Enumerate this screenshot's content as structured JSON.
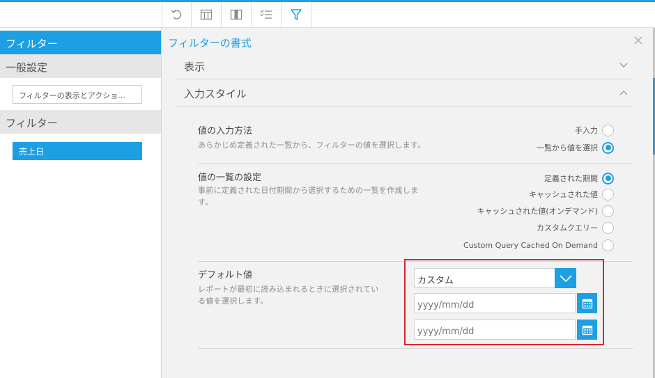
{
  "toolbar": {
    "icons": [
      "undo-icon",
      "table-icon",
      "column-icon",
      "list-icon",
      "filter-icon"
    ]
  },
  "sidebar": {
    "title": "フィルター",
    "general_section": "一般設定",
    "general_button": "フィルターの表示とアクショ...",
    "filter_section": "フィルター",
    "selected_filter": "売上日"
  },
  "main": {
    "title": "フィルターの書式",
    "accordion_display": "表示",
    "accordion_input_style": "入力スタイル",
    "input_method": {
      "title": "値の入力方法",
      "description": "あらかじめ定義された一覧から、フィルターの値を選択します。",
      "options": [
        {
          "label": "手入力",
          "selected": false
        },
        {
          "label": "一覧から値を選択",
          "selected": true
        }
      ]
    },
    "list_settings": {
      "title": "値の一覧の設定",
      "description_line1": "事前に定義された日付期間から選択するための一覧を作成しま",
      "description_line2": "す。",
      "options": [
        {
          "label": "定義された期間",
          "selected": true
        },
        {
          "label": "キャッシュされた値",
          "selected": false
        },
        {
          "label": "キャッシュされた値(オンデマンド)",
          "selected": false
        },
        {
          "label": "カスタムクエリー",
          "selected": false
        },
        {
          "label": "Custom Query Cached On Demand",
          "selected": false
        }
      ]
    },
    "default_value": {
      "title": "デフォルト値",
      "description_line1": "レポートが最初に読み込まれるときに選択されてい",
      "description_line2": "る値を選択します。",
      "select_value": "カスタム",
      "date_placeholder_1": "yyyy/mm/dd",
      "date_placeholder_2": "yyyy/mm/dd"
    }
  },
  "colors": {
    "accent": "#1d9fe3",
    "highlight_border": "#d9242f"
  }
}
